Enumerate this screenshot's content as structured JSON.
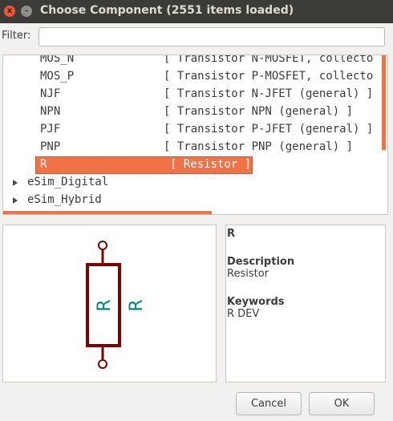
{
  "window": {
    "title": "Choose Component (2551 items loaded)",
    "close_glyph": "x",
    "minimize_glyph": "–"
  },
  "filter": {
    "label": "Filter:",
    "value": "",
    "placeholder": ""
  },
  "tree": {
    "rows": [
      {
        "name": "MOS_N",
        "desc": "[ Transistor N-MOSFET, collecto"
      },
      {
        "name": "MOS_P",
        "desc": "[ Transistor P-MOSFET, collecto"
      },
      {
        "name": "NJF",
        "desc": "[ Transistor N-JFET (general) ]"
      },
      {
        "name": "NPN",
        "desc": "[ Transistor NPN (general) ]"
      },
      {
        "name": "PJF",
        "desc": "[ Transistor P-JFET (general) ]"
      },
      {
        "name": "PNP",
        "desc": "[ Transistor PNP (general) ]"
      },
      {
        "name": "R",
        "desc": "[ Resistor ]"
      }
    ],
    "libraries": [
      {
        "name": "eSim_Digital"
      },
      {
        "name": "eSim_Hybrid"
      }
    ]
  },
  "preview": {
    "ref_label": "R",
    "value_label": "R",
    "body_color": "#800000",
    "text_color": "#008484"
  },
  "info": {
    "name": "R",
    "description_heading": "Description",
    "description": "Resistor",
    "keywords_heading": "Keywords",
    "keywords": "R DEV"
  },
  "buttons": {
    "cancel": "Cancel",
    "ok": "OK"
  },
  "colors": {
    "accent": "#ef7346",
    "titlebar": "#3c3b37"
  }
}
